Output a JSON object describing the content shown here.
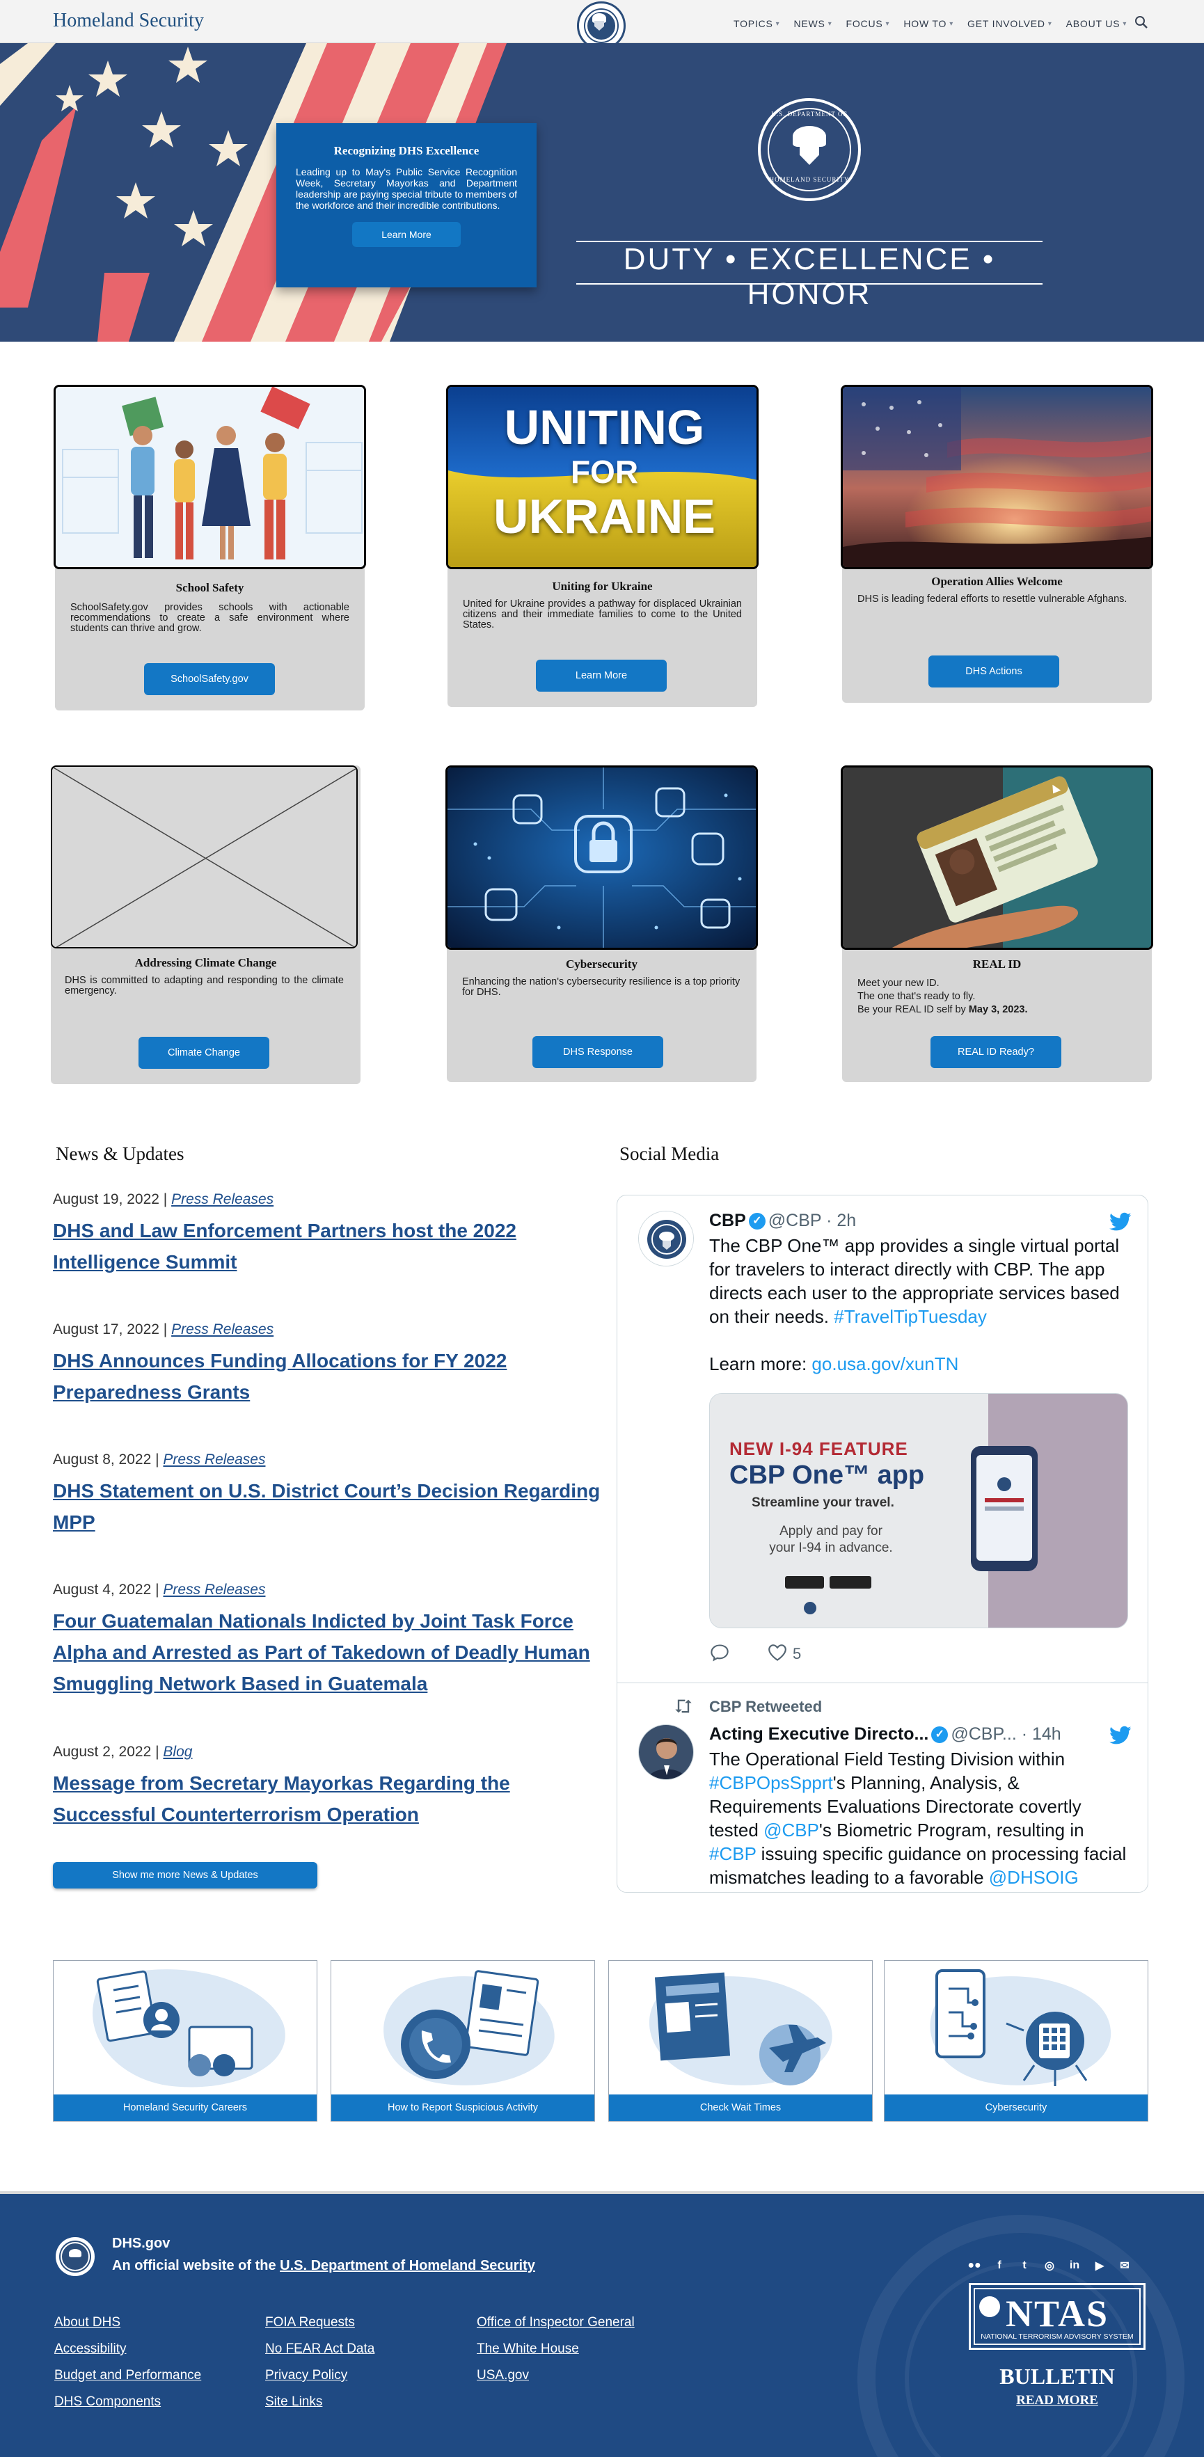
{
  "header": {
    "logo": "Homeland Security",
    "nav": [
      "TOPICS",
      "NEWS",
      "FOCUS",
      "HOW TO",
      "GET INVOLVED",
      "ABOUT US"
    ]
  },
  "hero": {
    "card_title": "Recognizing DHS Excellence",
    "card_text": "Leading up to May's Public Service Recognition Week, Secretary Mayorkas and Department leadership are paying special tribute to members of the workforce and their incredible contributions.",
    "card_button": "Learn More",
    "seal_top": "U.S. DEPARTMENT OF",
    "seal_bottom": "HOMELAND SECURITY",
    "motto": "DUTY • EXCELLENCE • HONOR"
  },
  "features": [
    {
      "title": "School Safety",
      "text": "SchoolSafety.gov provides schools with actionable recommendations to create a safe environment where students can thrive and grow.",
      "button": "SchoolSafety.gov"
    },
    {
      "title": "Uniting for Ukraine",
      "text": "United for Ukraine provides a pathway for displaced Ukrainian citizens and their immediate families to come to the United States.",
      "button": "Learn More",
      "img_line1": "UNITING",
      "img_line2": "FOR",
      "img_line3": "UKRAINE"
    },
    {
      "title": "Operation Allies Welcome",
      "text": "DHS is leading federal efforts to resettle vulnerable Afghans.",
      "button": "DHS Actions"
    },
    {
      "title": "Addressing Climate Change",
      "text": "DHS is committed to adapting and responding to the climate emergency.",
      "button": "Climate Change"
    },
    {
      "title": "Cybersecurity",
      "text": "Enhancing the nation's cybersecurity resilience is a top priority for DHS.",
      "button": "DHS Response"
    },
    {
      "title": "REAL ID",
      "text_line1": "Meet your new ID.",
      "text_line2": "The one that's ready to fly.",
      "text_line3_pre": "Be your REAL ID self by ",
      "text_line3_bold": "May 3, 2023.",
      "button": "REAL ID Ready?"
    }
  ],
  "news": {
    "heading": "News & Updates",
    "items": [
      {
        "date": "August 19, 2022 |",
        "category": "Press Releases",
        "title": "DHS and Law Enforcement Partners host the 2022 Intelligence Summit"
      },
      {
        "date": "August 17, 2022 |",
        "category": "Press Releases",
        "title": "DHS Announces Funding Allocations for FY 2022 Preparedness Grants"
      },
      {
        "date": "August 8, 2022 |",
        "category": "Press Releases",
        "title": "DHS Statement on U.S. District Court’s Decision Regarding MPP"
      },
      {
        "date": "August 4, 2022 |",
        "category": "Press Releases",
        "title": "Four Guatemalan Nationals Indicted by Joint Task Force Alpha and Arrested as Part of Takedown of Deadly Human Smuggling Network Based in Guatemala"
      },
      {
        "date": "August 2, 2022 |",
        "category": "Blog",
        "title": "Message from Secretary Mayorkas Regarding the Successful Counterterrorism Operation"
      }
    ],
    "more_button": "Show me more News & Updates"
  },
  "social": {
    "heading": "Social Media",
    "tweet1": {
      "name": "CBP",
      "handle": "@CBP · 2h",
      "body": "The CBP One™ app provides a single virtual portal for travelers to interact directly with CBP. The app directs each user to the appropriate services based on their needs.",
      "hashtag": "#TravelTipTuesday",
      "learn": "Learn more:",
      "link": "go.usa.gov/xunTN",
      "img_kicker": "NEW I-94 FEATURE",
      "img_title": "CBP One™ app",
      "img_sub": "Streamline your travel.",
      "img_apply1": "Apply and pay for",
      "img_apply2": "your I-94 in advance.",
      "likes": "5"
    },
    "tweet2": {
      "retweet": "CBP Retweeted",
      "name": "Acting Executive Directo...",
      "handle": "@CBP... · 14h",
      "b1": "The Operational Field Testing Division within ",
      "h1": "#CBPOpsSpprt",
      "b2": "'s Planning, Analysis, & Requirements Evaluations Directorate covertly tested ",
      "h2": "@CBP",
      "b3": "'s Biometric Program, resulting in ",
      "h3": "#CBP",
      "b4": " issuing specific guidance on processing facial mismatches leading to a favorable ",
      "h4": "@DHSOIG"
    }
  },
  "tiles": [
    "Homeland Security Careers",
    "How to Report Suspicious Activity",
    "Check Wait Times",
    "Cybersecurity"
  ],
  "footer": {
    "site": "DHS.gov",
    "official_pre": "An official website of the ",
    "official_link": "U.S. Department of Homeland Security",
    "col1": [
      "About DHS",
      "Accessibility",
      "Budget and Performance",
      "DHS Components"
    ],
    "col2": [
      "FOIA Requests",
      "No FEAR Act Data",
      "Privacy Policy",
      "Site Links"
    ],
    "col3": [
      "Office of Inspector General",
      "The White House",
      "USA.gov"
    ],
    "ntas": "NTAS",
    "ntas_sub": "NATIONAL TERRORISM ADVISORY SYSTEM",
    "bulletin": "BULLETIN",
    "read_more": "READ MORE"
  },
  "colors": {
    "brand_blue": "#1377c5",
    "navy": "#2f4a77",
    "link": "#1f4f8c",
    "footer": "#1f4a83",
    "flag_red": "#e8656c"
  }
}
